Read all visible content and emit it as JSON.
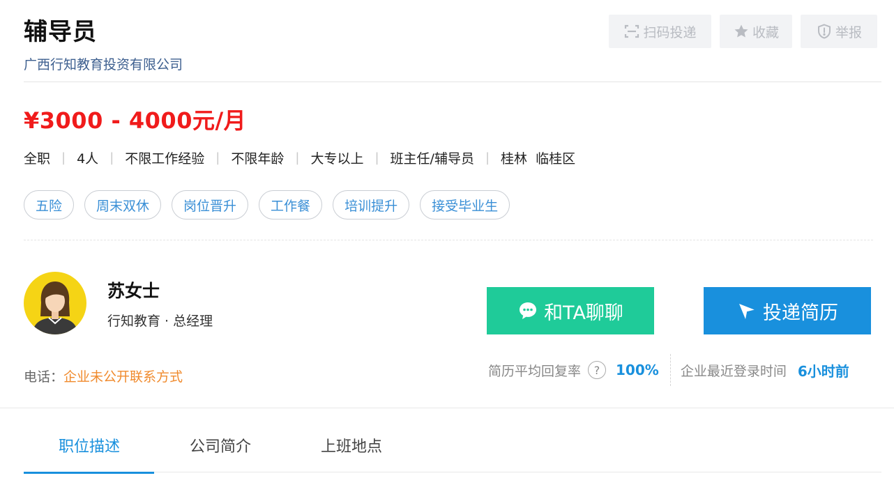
{
  "job": {
    "title": "辅导员",
    "company": "广西行知教育投资有限公司",
    "salary": "¥3000 - 4000元/月",
    "attributes": [
      "全职",
      "4人",
      "不限工作经验",
      "不限年龄",
      "大专以上",
      "班主任/辅导员",
      "桂林  临桂区"
    ],
    "tags": [
      "五险",
      "周末双休",
      "岗位晋升",
      "工作餐",
      "培训提升",
      "接受毕业生"
    ]
  },
  "actions": {
    "scan_label": "扫码投递",
    "favorite_label": "收藏",
    "report_label": "举报"
  },
  "contact": {
    "name": "苏女士",
    "role": "行知教育 · 总经理",
    "chat_label": "和TA聊聊",
    "apply_label": "投递简历",
    "phone_label": "电话：",
    "phone_value": "企业未公开联系方式"
  },
  "stats": {
    "reply_rate_label": "简历平均回复率",
    "help_glyph": "?",
    "reply_rate_value": "100%",
    "last_login_label": "企业最近登录时间",
    "last_login_value": "6小时前"
  },
  "tabs": [
    {
      "label": "职位描述",
      "active": true
    },
    {
      "label": "公司简介",
      "active": false
    },
    {
      "label": "上班地点",
      "active": false
    }
  ],
  "colors": {
    "salary": "#f01b1b",
    "chat_button": "#1fcb99",
    "apply_button": "#1990dd",
    "accent_blue": "#1990dd",
    "tag_text": "#3a8fd6",
    "phone_value": "#f08a2c",
    "company_link": "#3d5f8f",
    "avatar_bg": "#f5d415"
  },
  "icons": {
    "scan": "scan-icon",
    "favorite": "star-icon",
    "report": "shield-icon",
    "chat": "chat-bubble-icon",
    "apply": "paper-plane-icon",
    "help": "question-icon"
  }
}
